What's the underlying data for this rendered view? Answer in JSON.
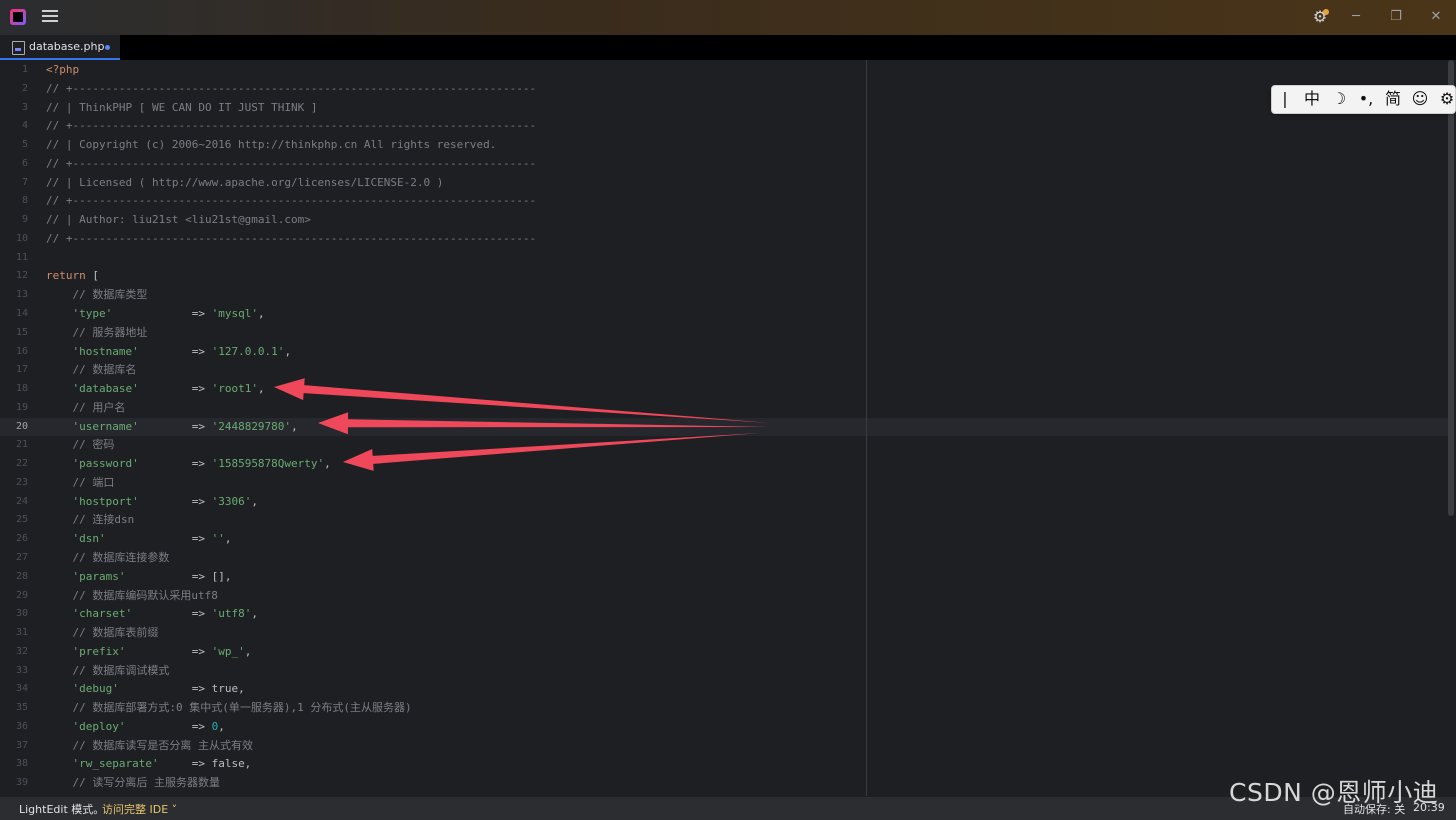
{
  "titlebar": {
    "settings_icon": "gear-icon",
    "menu_icon": "hamburger-icon",
    "minimize": "─",
    "maximize": "❐",
    "close": "✕"
  },
  "tab": {
    "label": "database.php",
    "modified": true
  },
  "editor": {
    "current_line": 20,
    "lines": [
      {
        "n": "1",
        "parts": [
          {
            "t": "<?php",
            "c": "kw"
          }
        ]
      },
      {
        "n": "2",
        "parts": [
          {
            "t": "// +----------------------------------------------------------------------",
            "c": "cmt"
          }
        ]
      },
      {
        "n": "3",
        "parts": [
          {
            "t": "// | ThinkPHP [ WE CAN DO IT JUST THINK ]",
            "c": "cmt"
          }
        ]
      },
      {
        "n": "4",
        "parts": [
          {
            "t": "// +----------------------------------------------------------------------",
            "c": "cmt"
          }
        ]
      },
      {
        "n": "5",
        "parts": [
          {
            "t": "// | Copyright (c) 2006~2016 http://thinkphp.cn All rights reserved.",
            "c": "cmt"
          }
        ]
      },
      {
        "n": "6",
        "parts": [
          {
            "t": "// +----------------------------------------------------------------------",
            "c": "cmt"
          }
        ]
      },
      {
        "n": "7",
        "parts": [
          {
            "t": "// | Licensed ( http://www.apache.org/licenses/LICENSE-2.0 )",
            "c": "cmt"
          }
        ]
      },
      {
        "n": "8",
        "parts": [
          {
            "t": "// +----------------------------------------------------------------------",
            "c": "cmt"
          }
        ]
      },
      {
        "n": "9",
        "parts": [
          {
            "t": "// | Author: liu21st <liu21st@gmail.com>",
            "c": "cmt"
          }
        ]
      },
      {
        "n": "10",
        "parts": [
          {
            "t": "// +----------------------------------------------------------------------",
            "c": "cmt"
          }
        ]
      },
      {
        "n": "11",
        "parts": []
      },
      {
        "n": "12",
        "parts": [
          {
            "t": "return",
            "c": "kw"
          },
          {
            "t": " [",
            "c": "plain"
          }
        ]
      },
      {
        "n": "13",
        "parts": [
          {
            "t": "    // 数据库类型",
            "c": "cmt"
          }
        ]
      },
      {
        "n": "14",
        "parts": [
          {
            "t": "    'type'",
            "c": "str"
          },
          {
            "t": "            => ",
            "c": "plain"
          },
          {
            "t": "'mysql'",
            "c": "str"
          },
          {
            "t": ",",
            "c": "plain"
          }
        ]
      },
      {
        "n": "15",
        "parts": [
          {
            "t": "    // 服务器地址",
            "c": "cmt"
          }
        ]
      },
      {
        "n": "16",
        "parts": [
          {
            "t": "    'hostname'",
            "c": "str"
          },
          {
            "t": "        => ",
            "c": "plain"
          },
          {
            "t": "'127.0.0.1'",
            "c": "str"
          },
          {
            "t": ",",
            "c": "plain"
          }
        ]
      },
      {
        "n": "17",
        "parts": [
          {
            "t": "    // 数据库名",
            "c": "cmt"
          }
        ]
      },
      {
        "n": "18",
        "parts": [
          {
            "t": "    'database'",
            "c": "str"
          },
          {
            "t": "        => ",
            "c": "plain"
          },
          {
            "t": "'root1'",
            "c": "str"
          },
          {
            "t": ",",
            "c": "plain"
          }
        ]
      },
      {
        "n": "19",
        "parts": [
          {
            "t": "    // 用户名",
            "c": "cmt"
          }
        ]
      },
      {
        "n": "20",
        "parts": [
          {
            "t": "    'username'",
            "c": "str"
          },
          {
            "t": "        => ",
            "c": "plain"
          },
          {
            "t": "'2448829780'",
            "c": "str"
          },
          {
            "t": ",",
            "c": "plain"
          }
        ]
      },
      {
        "n": "21",
        "parts": [
          {
            "t": "    // 密码",
            "c": "cmt"
          }
        ]
      },
      {
        "n": "22",
        "parts": [
          {
            "t": "    'password'",
            "c": "str"
          },
          {
            "t": "        => ",
            "c": "plain"
          },
          {
            "t": "'158595878Qwerty'",
            "c": "str"
          },
          {
            "t": ",",
            "c": "plain"
          }
        ]
      },
      {
        "n": "23",
        "parts": [
          {
            "t": "    // 端口",
            "c": "cmt"
          }
        ]
      },
      {
        "n": "24",
        "parts": [
          {
            "t": "    'hostport'",
            "c": "str"
          },
          {
            "t": "        => ",
            "c": "plain"
          },
          {
            "t": "'3306'",
            "c": "str"
          },
          {
            "t": ",",
            "c": "plain"
          }
        ]
      },
      {
        "n": "25",
        "parts": [
          {
            "t": "    // 连接dsn",
            "c": "cmt"
          }
        ]
      },
      {
        "n": "26",
        "parts": [
          {
            "t": "    'dsn'",
            "c": "str"
          },
          {
            "t": "             => ",
            "c": "plain"
          },
          {
            "t": "''",
            "c": "str"
          },
          {
            "t": ",",
            "c": "plain"
          }
        ]
      },
      {
        "n": "27",
        "parts": [
          {
            "t": "    // 数据库连接参数",
            "c": "cmt"
          }
        ]
      },
      {
        "n": "28",
        "parts": [
          {
            "t": "    'params'",
            "c": "str"
          },
          {
            "t": "          => [],",
            "c": "plain"
          }
        ]
      },
      {
        "n": "29",
        "parts": [
          {
            "t": "    // 数据库编码默认采用utf8",
            "c": "cmt"
          }
        ]
      },
      {
        "n": "30",
        "parts": [
          {
            "t": "    'charset'",
            "c": "str"
          },
          {
            "t": "         => ",
            "c": "plain"
          },
          {
            "t": "'utf8'",
            "c": "str"
          },
          {
            "t": ",",
            "c": "plain"
          }
        ]
      },
      {
        "n": "31",
        "parts": [
          {
            "t": "    // 数据库表前缀",
            "c": "cmt"
          }
        ]
      },
      {
        "n": "32",
        "parts": [
          {
            "t": "    'prefix'",
            "c": "str"
          },
          {
            "t": "          => ",
            "c": "plain"
          },
          {
            "t": "'wp_'",
            "c": "str"
          },
          {
            "t": ",",
            "c": "plain"
          }
        ]
      },
      {
        "n": "33",
        "parts": [
          {
            "t": "    // 数据库调试模式",
            "c": "cmt"
          }
        ]
      },
      {
        "n": "34",
        "parts": [
          {
            "t": "    'debug'",
            "c": "str"
          },
          {
            "t": "           => true,",
            "c": "plain"
          }
        ]
      },
      {
        "n": "35",
        "parts": [
          {
            "t": "    // 数据库部署方式:0 集中式(单一服务器),1 分布式(主从服务器)",
            "c": "cmt"
          }
        ]
      },
      {
        "n": "36",
        "parts": [
          {
            "t": "    'deploy'",
            "c": "str"
          },
          {
            "t": "          => ",
            "c": "plain"
          },
          {
            "t": "0",
            "c": "num"
          },
          {
            "t": ",",
            "c": "plain"
          }
        ]
      },
      {
        "n": "37",
        "parts": [
          {
            "t": "    // 数据库读写是否分离 主从式有效",
            "c": "cmt"
          }
        ]
      },
      {
        "n": "38",
        "parts": [
          {
            "t": "    'rw_separate'",
            "c": "str"
          },
          {
            "t": "     => false,",
            "c": "plain"
          }
        ]
      },
      {
        "n": "39",
        "parts": [
          {
            "t": "    // 读写分离后 主服务器数量",
            "c": "cmt"
          }
        ]
      }
    ]
  },
  "ime": [
    "|",
    "中",
    "☽",
    "•,",
    "简",
    "☺",
    "⚙"
  ],
  "status": {
    "mode": "LightEdit 模式。",
    "link": "访问完整 IDE ˅",
    "autosave": "自动保存: 关",
    "time": "20:39"
  },
  "watermark": "CSDN @恩师小迪",
  "annotation": {
    "arrow_color": "#f0485b",
    "arrow_targets": [
      "'root1'",
      "'2448829780'",
      "'158595878Qwerty'"
    ]
  }
}
